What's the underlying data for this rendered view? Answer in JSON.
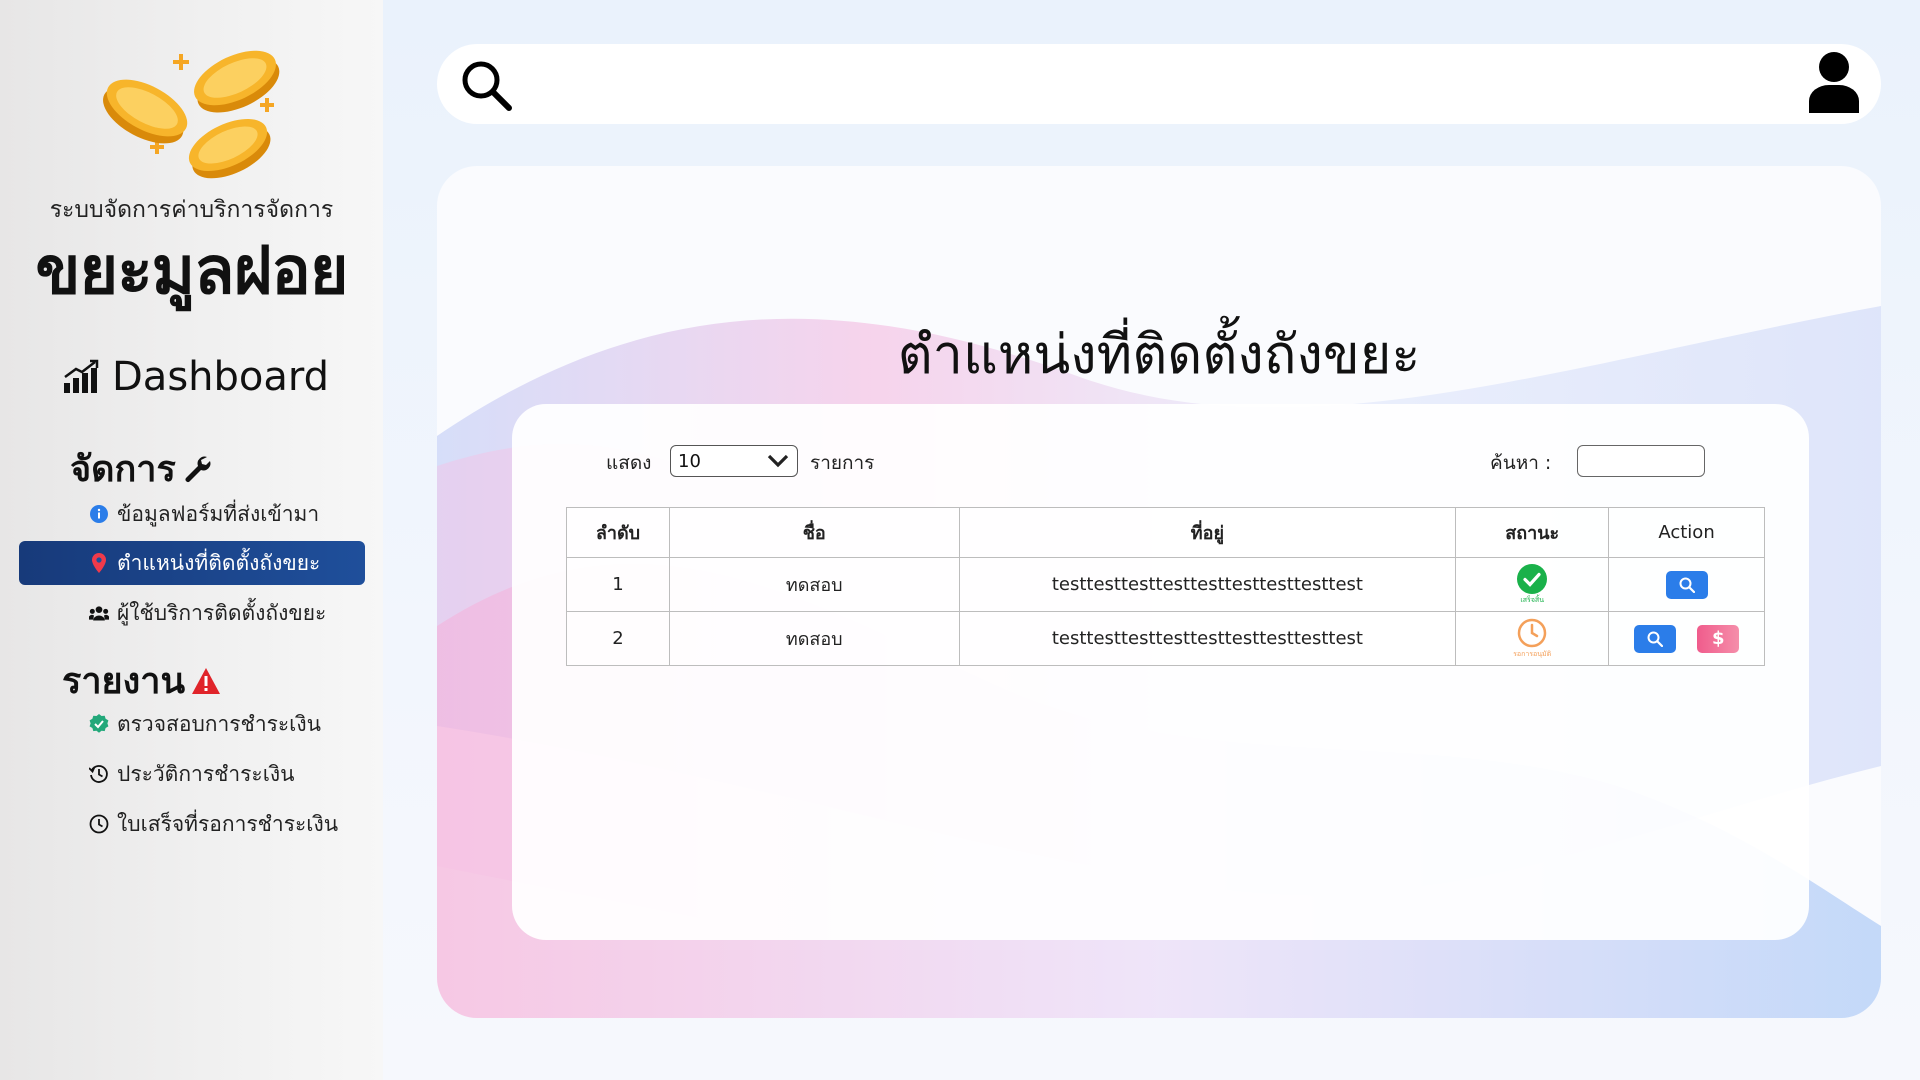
{
  "sidebar": {
    "brand_sub": "ระบบจัดการค่าบริการจัดการ",
    "brand_main": "ขยะมูลฝอย",
    "dashboard_label": "Dashboard",
    "manage_title": "จัดการ",
    "manage_items": [
      {
        "label": "ข้อมูลฟอร์มที่ส่งเข้ามา",
        "icon": "info-icon"
      },
      {
        "label": "ตำแหน่งที่ติดตั้งถังขยะ",
        "icon": "map-pin-icon",
        "active": true
      },
      {
        "label": "ผู้ใช้บริการติดตั้งถังขยะ",
        "icon": "users-icon"
      }
    ],
    "report_title": "รายงาน",
    "report_items": [
      {
        "label": "ตรวจสอบการชำระเงิน",
        "icon": "verified-badge-icon"
      },
      {
        "label": "ประวัติการชำระเงิน",
        "icon": "history-icon"
      },
      {
        "label": "ใบเสร็จที่รอการชำระเงิน",
        "icon": "clock-icon"
      }
    ]
  },
  "main": {
    "page_title": "ตำแหน่งที่ติดตั้งถังขยะ",
    "show_label": "แสดง",
    "page_size": "10",
    "entries_label": "รายการ",
    "search_label": "ค้นหา :",
    "search_value": "",
    "table": {
      "columns": [
        "ลำดับ",
        "ชื่อ",
        "ที่อยู่",
        "สถานะ",
        "Action"
      ],
      "rows": [
        {
          "no": "1",
          "name": "ทดสอบ",
          "address": "testtesttesttesttesttesttesttesttest",
          "status": "เสร็จสิ้น",
          "status_type": "done"
        },
        {
          "no": "2",
          "name": "ทดสอบ",
          "address": "testtesttesttesttesttesttesttesttest",
          "status": "รอการอนุมัติ",
          "status_type": "pending",
          "pay_symbol": "$"
        }
      ]
    }
  },
  "colors": {
    "active_nav": "#1f4f9b",
    "status_done": "#1ab14a",
    "status_pending": "#f4a05a",
    "action_blue": "#2b7de9",
    "action_pink": "#f05c8c",
    "alert_red": "#e0242a"
  }
}
